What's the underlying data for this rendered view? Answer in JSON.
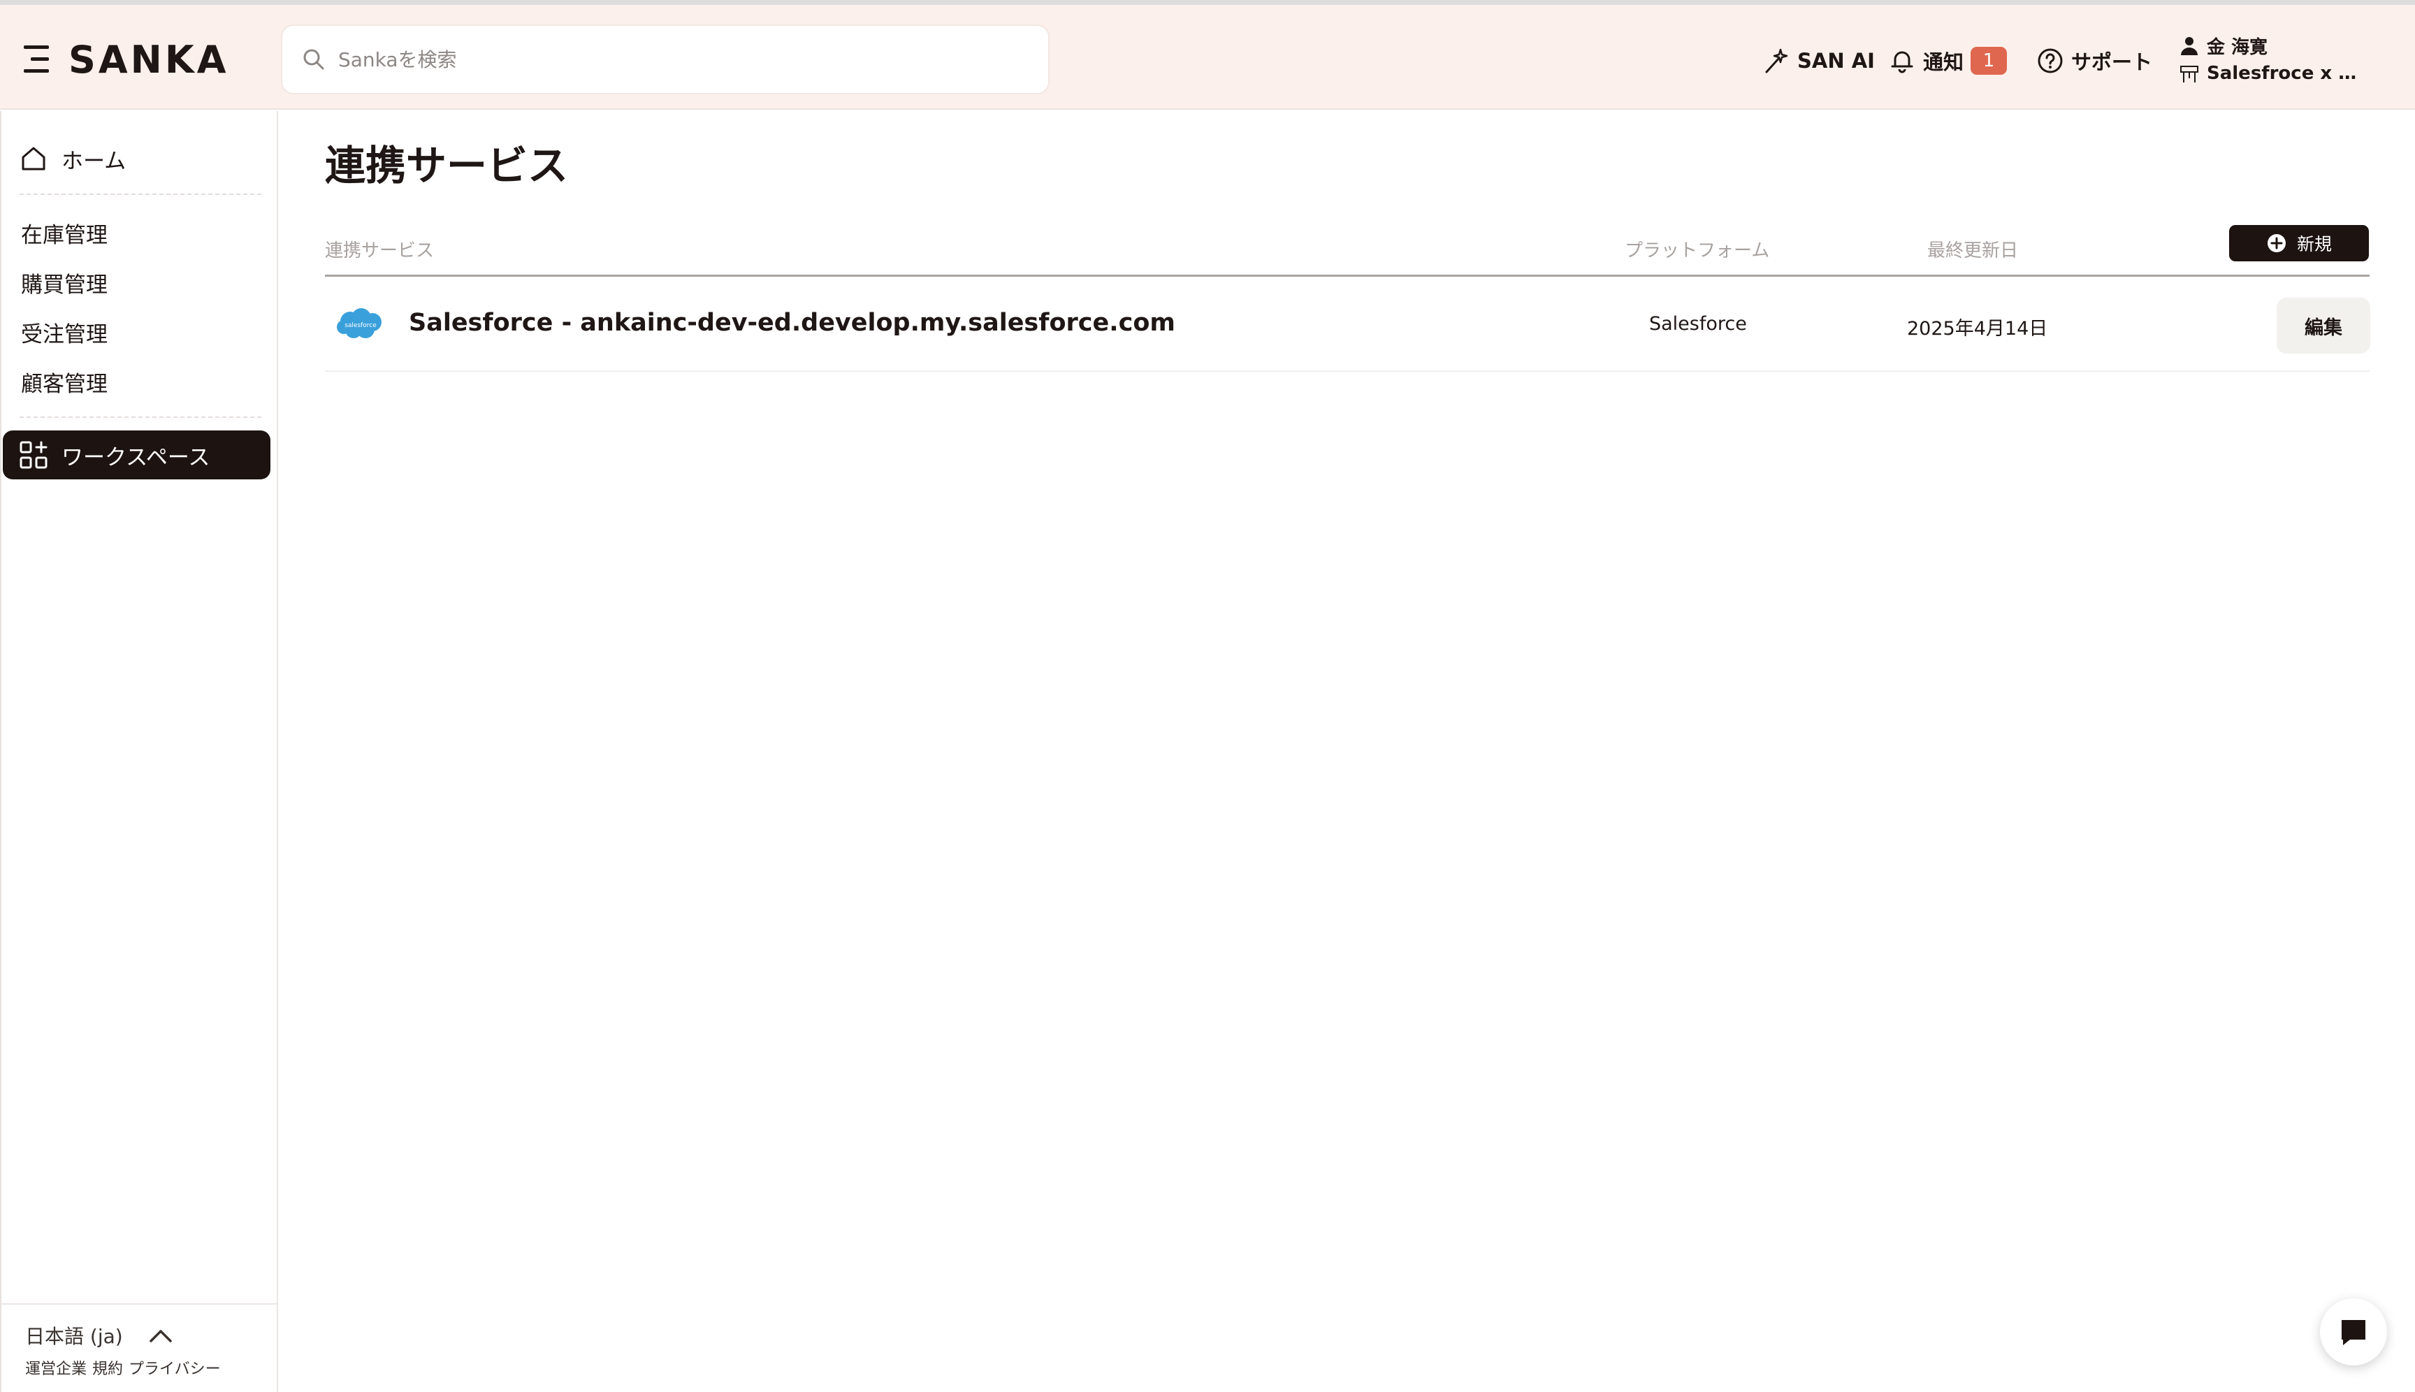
{
  "app": {
    "name": "SANKA"
  },
  "search": {
    "placeholder": "Sankaを検索"
  },
  "header": {
    "san_ai": "SAN AI",
    "notifications": "通知",
    "notification_count": "1",
    "support": "サポート",
    "user_name": "金 海寛",
    "workspace": "Salesfroce x Hub…"
  },
  "sidebar": {
    "home": "ホーム",
    "items": [
      {
        "label": "在庫管理"
      },
      {
        "label": "購買管理"
      },
      {
        "label": "受注管理"
      },
      {
        "label": "顧客管理"
      }
    ],
    "active": "ワークスペース",
    "language": "日本語 (ja)",
    "footer_links": [
      "運営企業",
      "規約",
      "プライバシー"
    ]
  },
  "main": {
    "title": "連携サービス",
    "columns": [
      "連携サービス",
      "プラットフォーム",
      "最終更新日"
    ],
    "new_button": "新規",
    "rows": [
      {
        "logo_text": "salesforce",
        "name": "Salesforce - ankainc-dev-ed.develop.my.salesforce.com",
        "platform": "Salesforce",
        "updated": "2025年4月14日",
        "action": "編集"
      }
    ]
  },
  "colors": {
    "header_bg": "#fbf0eb",
    "dark": "#1d1311",
    "badge": "#e0674f",
    "salesforce_blue": "#3aa0db"
  },
  "icons": [
    "menu-icon",
    "search-icon",
    "wand-icon",
    "bell-icon",
    "help-icon",
    "user-icon",
    "workspace-icon",
    "home-icon",
    "apps-icon",
    "chevron-up-icon",
    "plus-circle-icon",
    "chat-icon",
    "salesforce-logo"
  ]
}
